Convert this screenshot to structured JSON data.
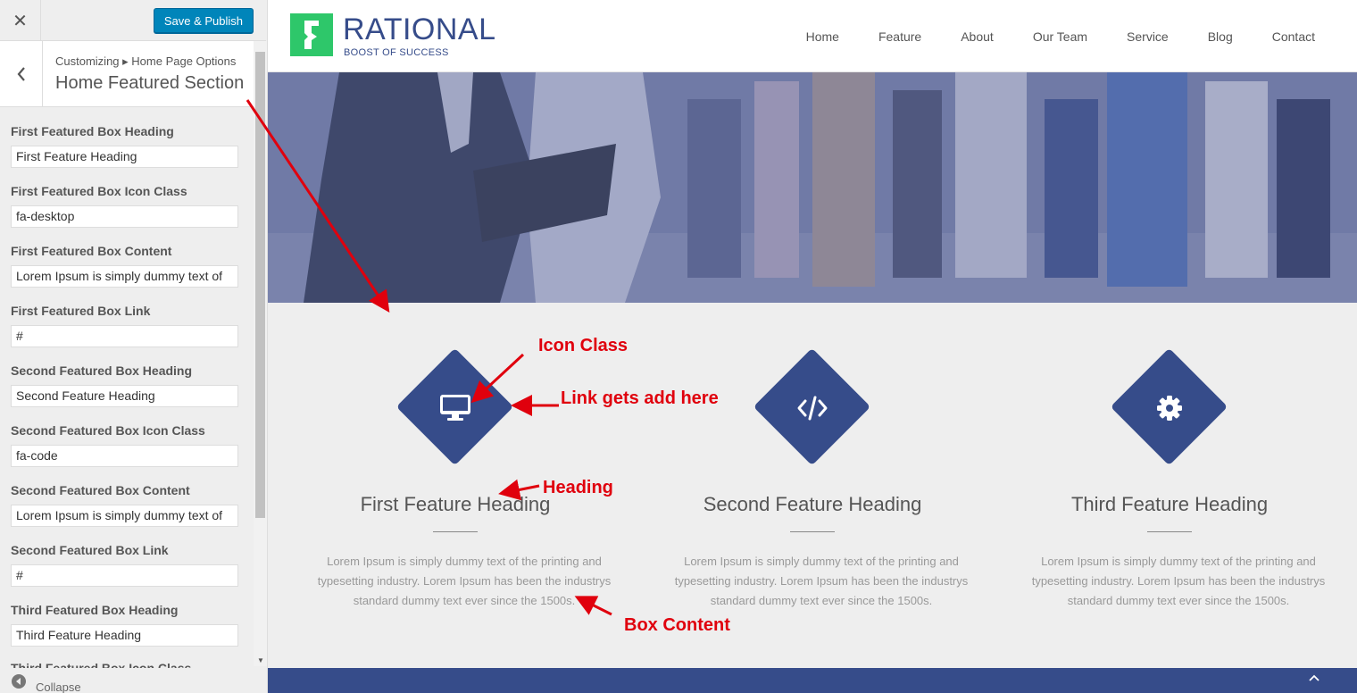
{
  "customizer": {
    "close_label": "✕",
    "publish_label": "Save & Publish",
    "breadcrumb": "Customizing ▸ Home Page Options",
    "section_title": "Home Featured Section",
    "fields": [
      {
        "label": "First Featured Box Heading",
        "value": "First Feature Heading"
      },
      {
        "label": "First Featured Box Icon Class",
        "value": "fa-desktop"
      },
      {
        "label": "First Featured Box Content",
        "value": "Lorem Ipsum is simply dummy text of"
      },
      {
        "label": "First Featured Box Link",
        "value": "#"
      },
      {
        "label": "Second Featured Box Heading",
        "value": "Second Feature Heading"
      },
      {
        "label": "Second Featured Box Icon Class",
        "value": "fa-code"
      },
      {
        "label": "Second Featured Box Content",
        "value": "Lorem Ipsum is simply dummy text of"
      },
      {
        "label": "Second Featured Box Link",
        "value": "#"
      },
      {
        "label": "Third Featured Box Heading",
        "value": "Third Feature Heading"
      }
    ],
    "partial_label": "Third Featured Box Icon Class",
    "collapse_label": "Collapse"
  },
  "site": {
    "logo_name": "RATIONAL",
    "logo_tagline": "BOOST OF SUCCESS",
    "nav": [
      "Home",
      "Feature",
      "About",
      "Our Team",
      "Service",
      "Blog",
      "Contact"
    ],
    "features": [
      {
        "icon": "desktop-icon",
        "heading": "First Feature Heading",
        "text": "Lorem Ipsum is simply dummy text of the printing and typesetting industry. Lorem Ipsum has been the industrys standard dummy text ever since the 1500s."
      },
      {
        "icon": "code-icon",
        "heading": "Second Feature Heading",
        "text": "Lorem Ipsum is simply dummy text of the printing and typesetting industry. Lorem Ipsum has been the industrys standard dummy text ever since the 1500s."
      },
      {
        "icon": "gear-icon",
        "heading": "Third Feature Heading",
        "text": "Lorem Ipsum is simply dummy text of the printing and typesetting industry. Lorem Ipsum has been the industrys standard dummy text ever since the 1500s."
      }
    ]
  },
  "annotations": {
    "icon_class": "Icon Class",
    "link": "Link gets add here",
    "heading": "Heading",
    "box_content": "Box Content"
  },
  "colors": {
    "brand_blue": "#364c8a",
    "logo_green": "#2ec76a",
    "publish_blue": "#0085ba",
    "annotation_red": "#e0000d"
  }
}
